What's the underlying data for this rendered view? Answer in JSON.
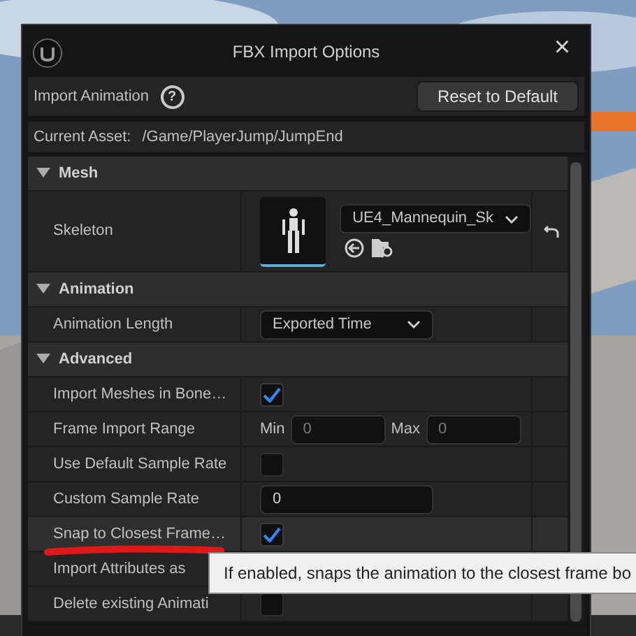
{
  "window": {
    "title": "FBX Import Options",
    "close": "×"
  },
  "header": {
    "title": "Import Animation",
    "help": "?",
    "reset_button": "Reset to Default"
  },
  "current_asset": {
    "label": "Current Asset:",
    "value": "/Game/PlayerJump/JumpEnd"
  },
  "properties": [
    {
      "kind": "section",
      "label": "Mesh",
      "expanded": true
    },
    {
      "kind": "skeleton",
      "label": "Skeleton",
      "value": "UE4_Mannequin_Sk"
    },
    {
      "kind": "section",
      "label": "Animation",
      "expanded": true
    },
    {
      "kind": "dropdown",
      "label": "Animation Length",
      "value": "Exported Time"
    },
    {
      "kind": "section",
      "label": "Advanced",
      "expanded": true
    },
    {
      "kind": "checkbox",
      "label": "Import Meshes in Bone…",
      "checked": true
    },
    {
      "kind": "range",
      "label": "Frame Import Range",
      "min_label": "Min",
      "min_value": "0",
      "max_label": "Max",
      "max_value": "0"
    },
    {
      "kind": "checkbox",
      "label": "Use Default Sample Rate",
      "checked": false
    },
    {
      "kind": "number",
      "label": "Custom Sample Rate",
      "value": "0"
    },
    {
      "kind": "checkbox",
      "label": "Snap to Closest Frame…",
      "checked": true,
      "hovered": true
    },
    {
      "kind": "plain",
      "label": "Import Attributes as"
    },
    {
      "kind": "checkbox",
      "label": "Delete existing Animati",
      "checked": false
    }
  ],
  "tooltip": {
    "text": "If enabled, snaps the animation to the closest frame bo"
  }
}
